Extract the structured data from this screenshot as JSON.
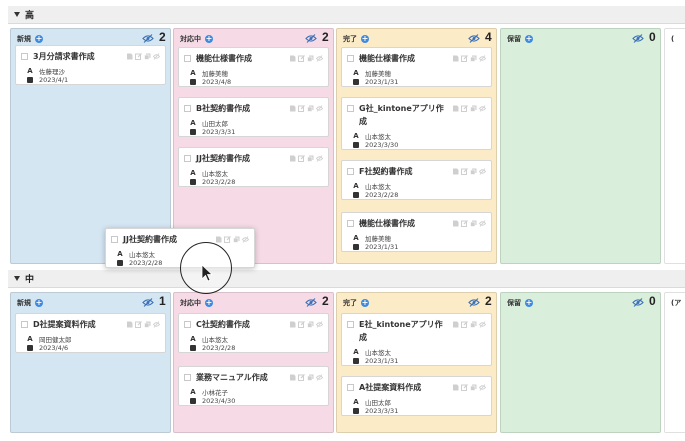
{
  "groups": [
    {
      "title": "高",
      "lanes": [
        {
          "name": "新規",
          "count": "2",
          "cards": [
            {
              "title": "3月分請求書作成",
              "person": "佐藤理沙",
              "date": "2023/4/1"
            }
          ]
        },
        {
          "name": "対応中",
          "count": "2",
          "cards": [
            {
              "title": "機能仕様書作成",
              "person": "加藤美穂",
              "date": "2023/4/8"
            },
            {
              "title": "B社契約書作成",
              "person": "山田太郎",
              "date": "2023/3/31"
            },
            {
              "title": "JJ社契約書作成",
              "person": "山本悠太",
              "date": "2023/2/28"
            }
          ]
        },
        {
          "name": "完了",
          "count": "4",
          "cards": [
            {
              "title": "機能仕様書作成",
              "person": "加藤美穂",
              "date": "2023/1/31"
            },
            {
              "title": "G社_kintoneアプリ作",
              "title2": "成",
              "person": "山本悠太",
              "date": "2023/3/30"
            },
            {
              "title": "F社契約書作成",
              "person": "山本悠太",
              "date": "2023/2/28"
            },
            {
              "title": "機能仕様書作成",
              "person": "加藤美穂",
              "date": "2023/1/31"
            }
          ]
        },
        {
          "name": "保留",
          "count": "0",
          "cards": []
        },
        {
          "name": "(",
          "count": "",
          "cards": []
        }
      ]
    },
    {
      "title": "中",
      "lanes": [
        {
          "name": "新規",
          "count": "1",
          "cards": [
            {
              "title": "D社提案資料作成",
              "person": "岡田健太郎",
              "date": "2023/4/6"
            }
          ]
        },
        {
          "name": "対応中",
          "count": "2",
          "cards": [
            {
              "title": "C社契約書作成",
              "person": "山本悠太",
              "date": "2023/2/28"
            },
            {
              "title": "業務マニュアル作成",
              "person": "小林花子",
              "date": "2023/4/30"
            }
          ]
        },
        {
          "name": "完了",
          "count": "2",
          "cards": [
            {
              "title": "E社_kintoneアプリ作",
              "title2": "成",
              "person": "山本悠太",
              "date": "2023/1/31"
            },
            {
              "title": "A社提案資料作成",
              "person": "山田太郎",
              "date": "2023/3/31"
            }
          ]
        },
        {
          "name": "保留",
          "count": "0",
          "cards": []
        },
        {
          "name": "(ア",
          "count": "",
          "cards": []
        }
      ]
    }
  ],
  "dragged_card": {
    "title": "JJ社契約書作成",
    "person": "山本悠太",
    "date": "2023/2/28"
  },
  "icons": {
    "person": "A",
    "calendar": "calendar-icon"
  },
  "colors": {
    "new": "#d5e6f3",
    "in_progress": "#f6dbe6",
    "done": "#fcebc7",
    "hold": "#d9efdb",
    "accent": "#3f8ae0"
  }
}
